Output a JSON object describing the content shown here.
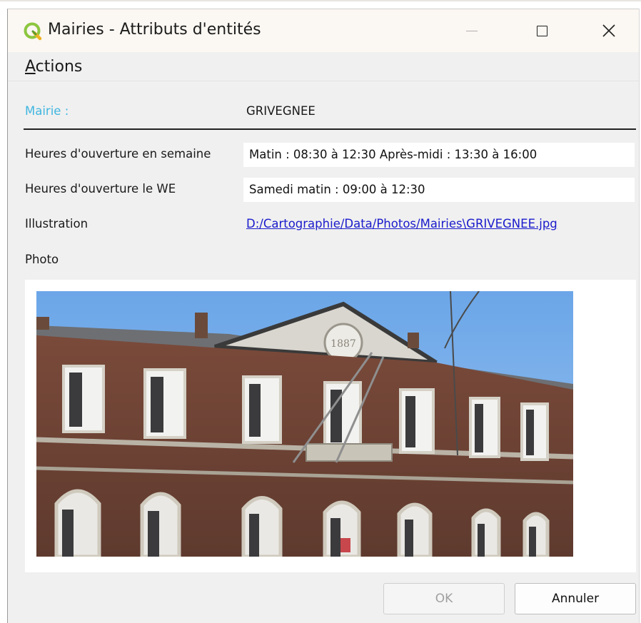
{
  "window": {
    "title": "Mairies - Attributs d'entités",
    "controls": {
      "minimize_icon": "minimize-icon",
      "maximize_icon": "maximize-icon",
      "close_icon": "close-icon"
    }
  },
  "menu": {
    "actions_mnemonic": "A",
    "actions_rest": "ctions"
  },
  "form": {
    "mairie": {
      "label": "Mairie :",
      "value": "GRIVEGNEE",
      "label_color": "#3fb6e0"
    },
    "semaine": {
      "label": "Heures d'ouverture en semaine",
      "value": "Matin : 08:30 à 12:30  Après-midi : 13:30 à 16:00"
    },
    "we": {
      "label": "Heures d'ouverture le WE",
      "value": "Samedi matin : 09:00 à 12:30"
    },
    "illustration": {
      "label": "Illustration",
      "value": "D:/Cartographie/Data/Photos/Mairies\\GRIVEGNEE.jpg",
      "link_color": "#1a1acc"
    },
    "photo": {
      "label": "Photo",
      "pediment_date": "1887"
    }
  },
  "buttons": {
    "ok": "OK",
    "cancel": "Annuler"
  }
}
